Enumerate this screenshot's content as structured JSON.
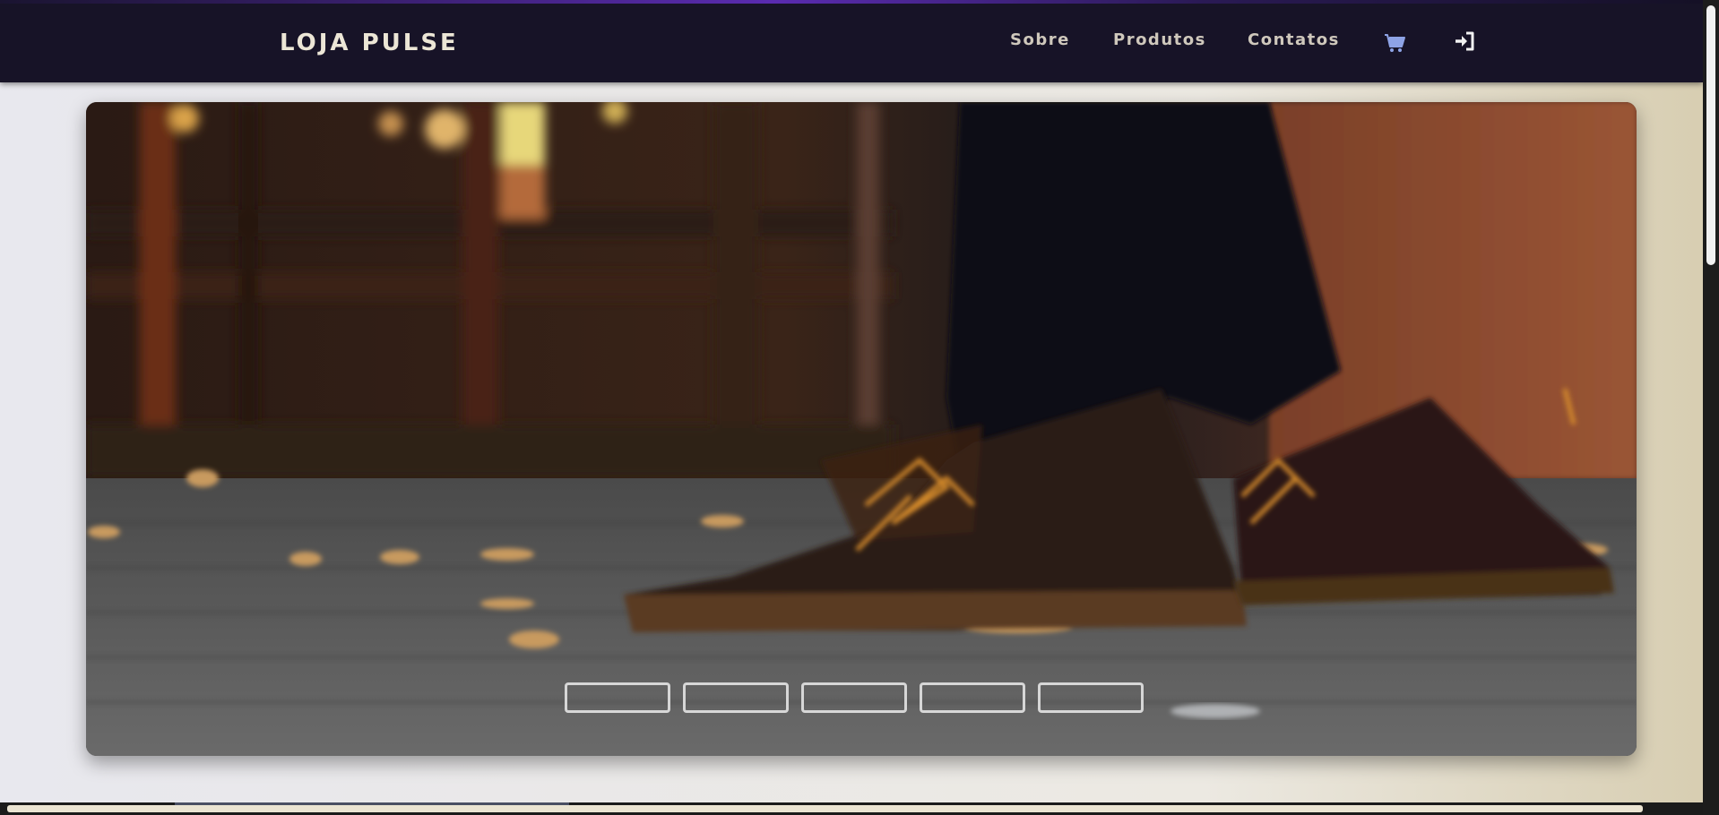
{
  "brand": {
    "title": "LOJA PULSE"
  },
  "nav": {
    "items": [
      {
        "label": "Sobre"
      },
      {
        "label": "Produtos"
      },
      {
        "label": "Contatos"
      }
    ],
    "cart_icon": "shopping-cart-icon",
    "login_icon": "sign-in-icon"
  },
  "carousel": {
    "image_subject": "leather-boots-on-wooden-deck",
    "slide_count": 5,
    "active_slide": 1
  },
  "colors": {
    "navbar": "#171327",
    "accent_glow": "#5a2bb0",
    "brand_text": "#ece6d6",
    "cart_icon": "#8ea3e6"
  }
}
